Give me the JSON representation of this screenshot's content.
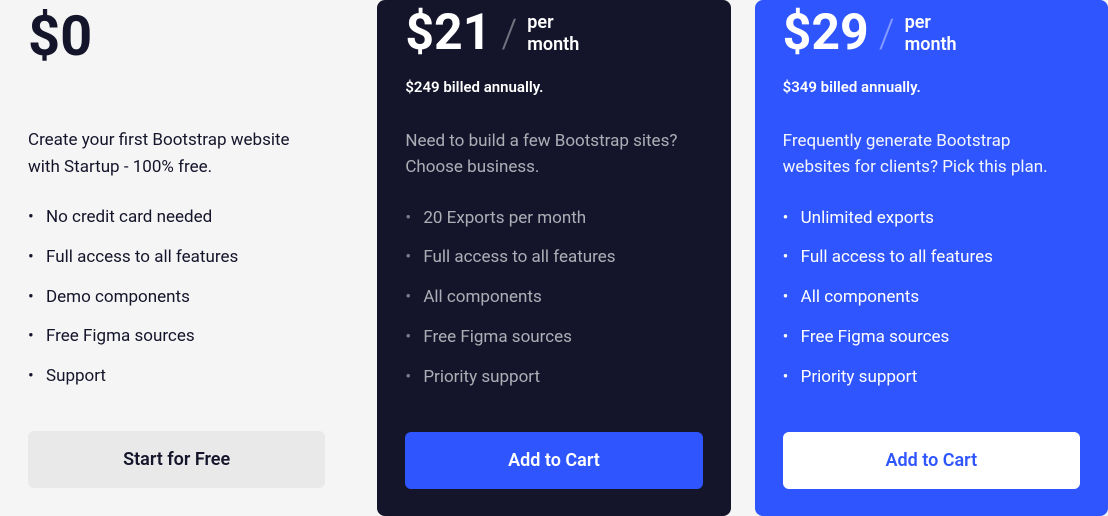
{
  "plans": [
    {
      "price": "$0",
      "period": "",
      "billing": "",
      "description": "Create your first Bootstrap website with Startup - 100% free.",
      "features": [
        "No credit card needed",
        "Full access to all features",
        "Demo components",
        "Free Figma sources",
        "Support"
      ],
      "cta": "Start for Free"
    },
    {
      "price": "$21",
      "period_line1": "per",
      "period_line2": "month",
      "billing": "$249 billed annually.",
      "description": "Need to build a few Bootstrap sites? Choose business.",
      "features": [
        "20 Exports per month",
        "Full access to all features",
        "All components",
        "Free Figma sources",
        "Priority support"
      ],
      "cta": "Add to Cart"
    },
    {
      "price": "$29",
      "period_line1": "per",
      "period_line2": "month",
      "billing": "$349 billed annually.",
      "description": "Frequently generate Bootstrap websites for clients? Pick this plan.",
      "features": [
        "Unlimited exports",
        "Full access to all features",
        "All components",
        "Free Figma sources",
        "Priority support"
      ],
      "cta": "Add to Cart"
    }
  ]
}
